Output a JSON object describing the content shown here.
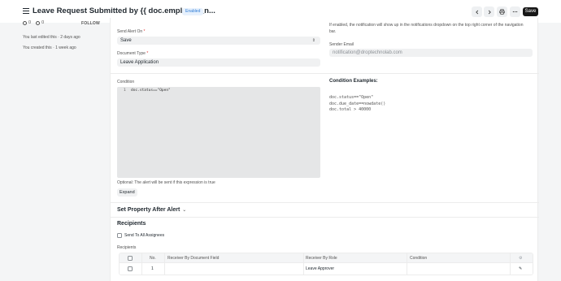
{
  "header": {
    "title": "Leave Request Submitted by {{ doc.employee_n...",
    "status_badge": "Enabled",
    "prev_icon": "chevron-left-icon",
    "next_icon": "chevron-right-icon",
    "print_icon": "printer-icon",
    "more_icon": "more-horizontal-icon",
    "save_label": "Save"
  },
  "sidebar": {
    "likes": "0",
    "comments": "0",
    "follow_label": "FOLLOW",
    "last_edited": "You last edited this · 2 days ago",
    "created": "You created this · 1 week ago"
  },
  "form": {
    "send_alert_on": {
      "label": "Send Alert On",
      "required_mark": "*",
      "value": "Save"
    },
    "document_type": {
      "label": "Document Type",
      "required_mark": "*",
      "value": "Leave Application"
    },
    "system_notification_help": "If enabled, the notification will show up in the notifications dropdown on the top right corner of the navigation bar.",
    "sender_email": {
      "label": "Sender Email",
      "placeholder": "notification@droptechnolab.com"
    },
    "condition": {
      "label": "Condition",
      "line_number": "1",
      "code": "doc.status==\"Open\"",
      "help": "Optional: The alert will be sent if this expression is true",
      "expand_label": "Expand"
    },
    "condition_examples": {
      "title": "Condition Examples:",
      "lines": [
        "doc.status==\"Open\"",
        "doc.due_date==nowdate()",
        "doc.total > 40000"
      ]
    },
    "set_property_section": "Set Property After Alert",
    "recipients_section": "Recipients",
    "send_to_all_assignees": "Send To All Assignees",
    "recipients_table": {
      "label": "Recipients",
      "columns": [
        "No.",
        "Receiver By Document Field",
        "Receiver By Role",
        "Condition"
      ],
      "rows": [
        {
          "no": "1",
          "document_field": "",
          "role": "Leave Approver",
          "condition": ""
        }
      ]
    }
  },
  "colors": {
    "accent_badge_bg": "#e7f1fd",
    "accent_badge_text": "#2f7dd6",
    "save_button": "#171717"
  }
}
